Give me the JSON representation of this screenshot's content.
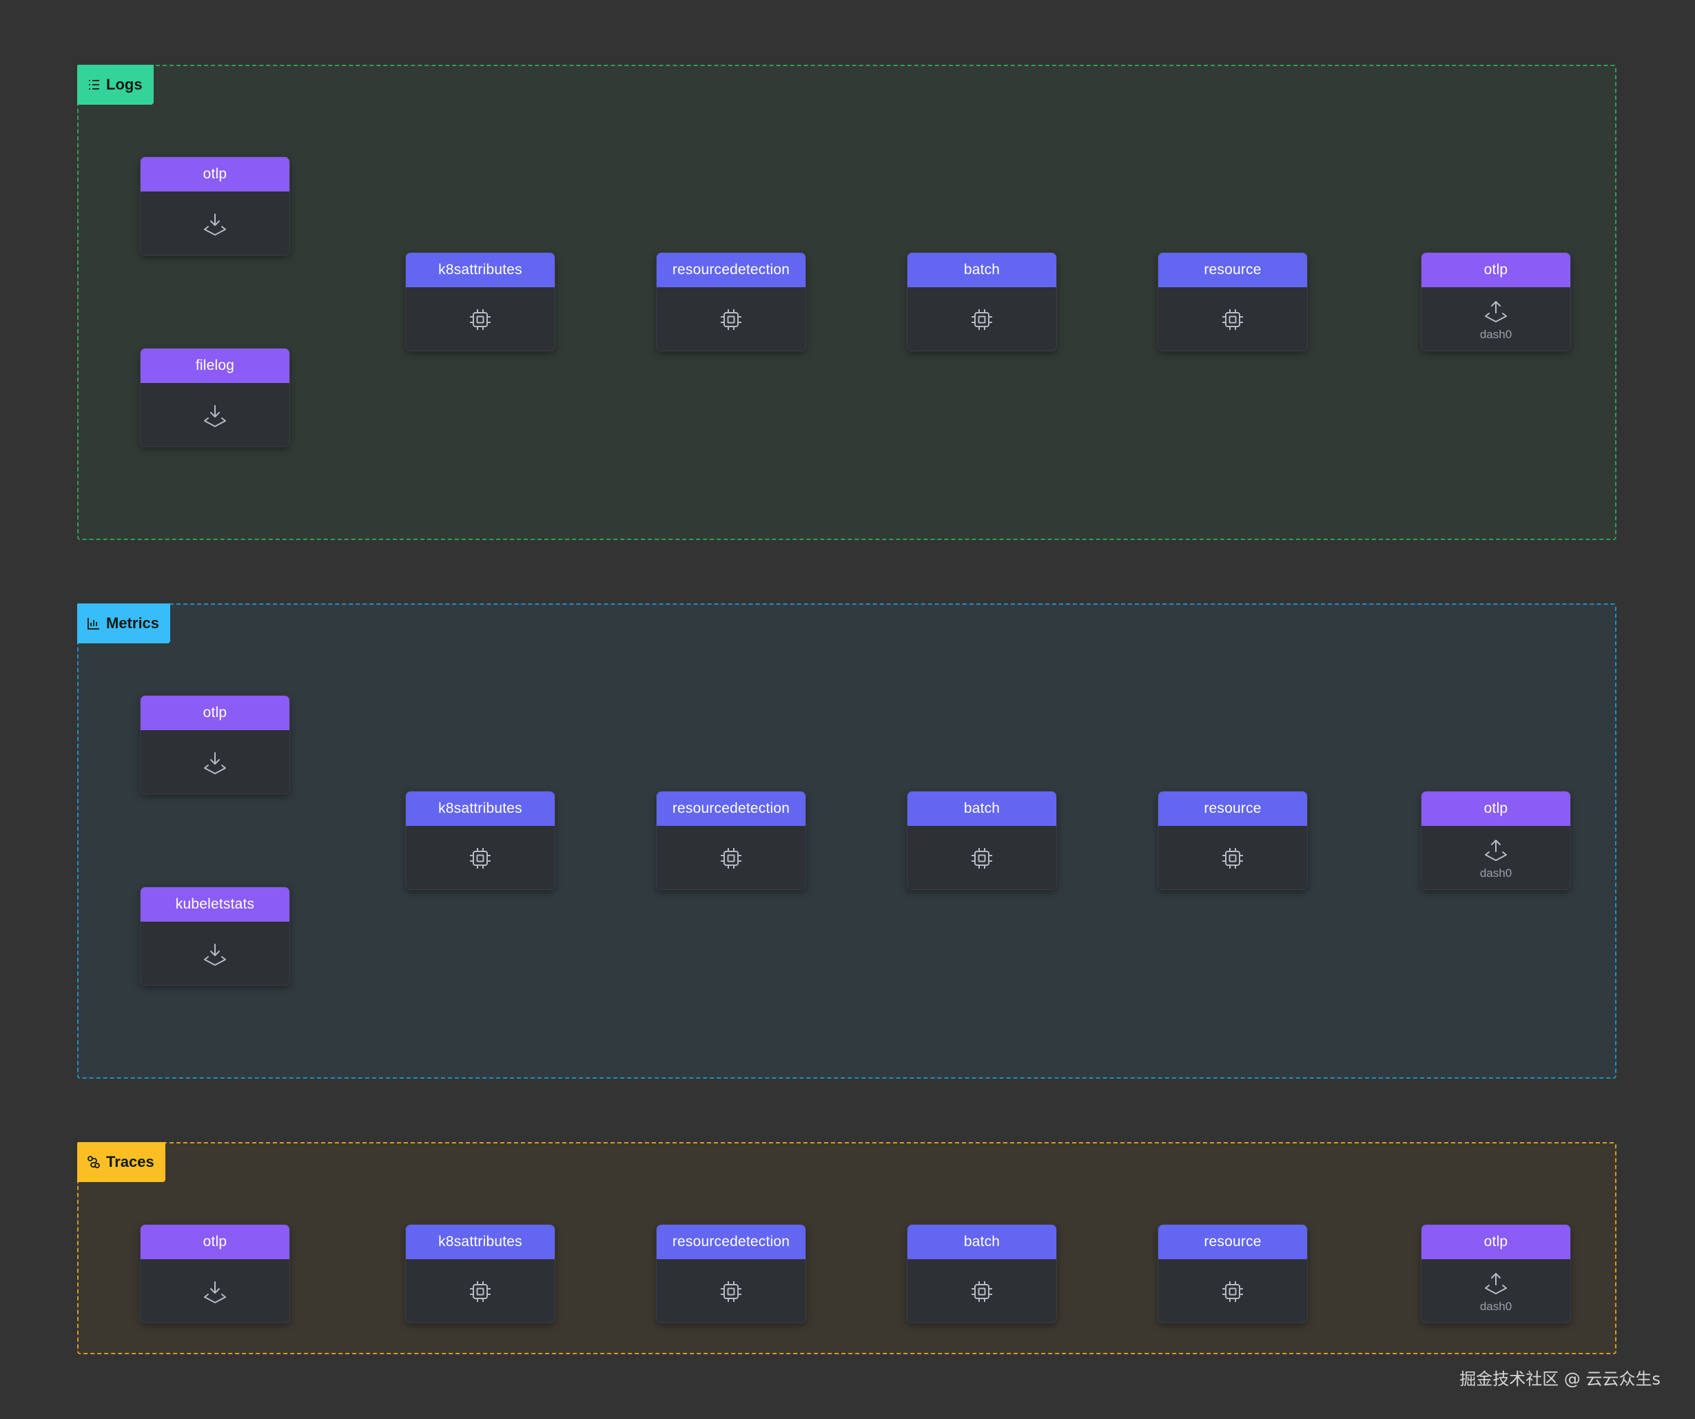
{
  "pipelines": [
    {
      "id": "logs",
      "label": "Logs",
      "receivers": [
        {
          "label": "otlp"
        },
        {
          "label": "filelog"
        }
      ],
      "processors": [
        {
          "label": "k8sattributes"
        },
        {
          "label": "resourcedetection"
        },
        {
          "label": "batch"
        },
        {
          "label": "resource"
        }
      ],
      "exporter": {
        "label": "otlp",
        "sub": "dash0"
      }
    },
    {
      "id": "metrics",
      "label": "Metrics",
      "receivers": [
        {
          "label": "otlp"
        },
        {
          "label": "kubeletstats"
        }
      ],
      "processors": [
        {
          "label": "k8sattributes"
        },
        {
          "label": "resourcedetection"
        },
        {
          "label": "batch"
        },
        {
          "label": "resource"
        }
      ],
      "exporter": {
        "label": "otlp",
        "sub": "dash0"
      }
    },
    {
      "id": "traces",
      "label": "Traces",
      "receivers": [
        {
          "label": "otlp"
        }
      ],
      "processors": [
        {
          "label": "k8sattributes"
        },
        {
          "label": "resourcedetection"
        },
        {
          "label": "batch"
        },
        {
          "label": "resource"
        }
      ],
      "exporter": {
        "label": "otlp",
        "sub": "dash0"
      }
    }
  ],
  "icons": {
    "receiver": "download-icon",
    "processor": "cpu-chip-icon",
    "exporter": "upload-icon",
    "logs": "list-icon",
    "metrics": "bar-chart-icon",
    "traces": "trace-route-icon"
  },
  "colors": {
    "receiver": "#8b5cf6",
    "processor": "#6366f1",
    "exporter": "#8b5cf6",
    "logs": "#34d399",
    "metrics": "#38bdf8",
    "traces": "#fbbf24"
  },
  "watermark": "掘金技术社区 @ 云云众生s"
}
